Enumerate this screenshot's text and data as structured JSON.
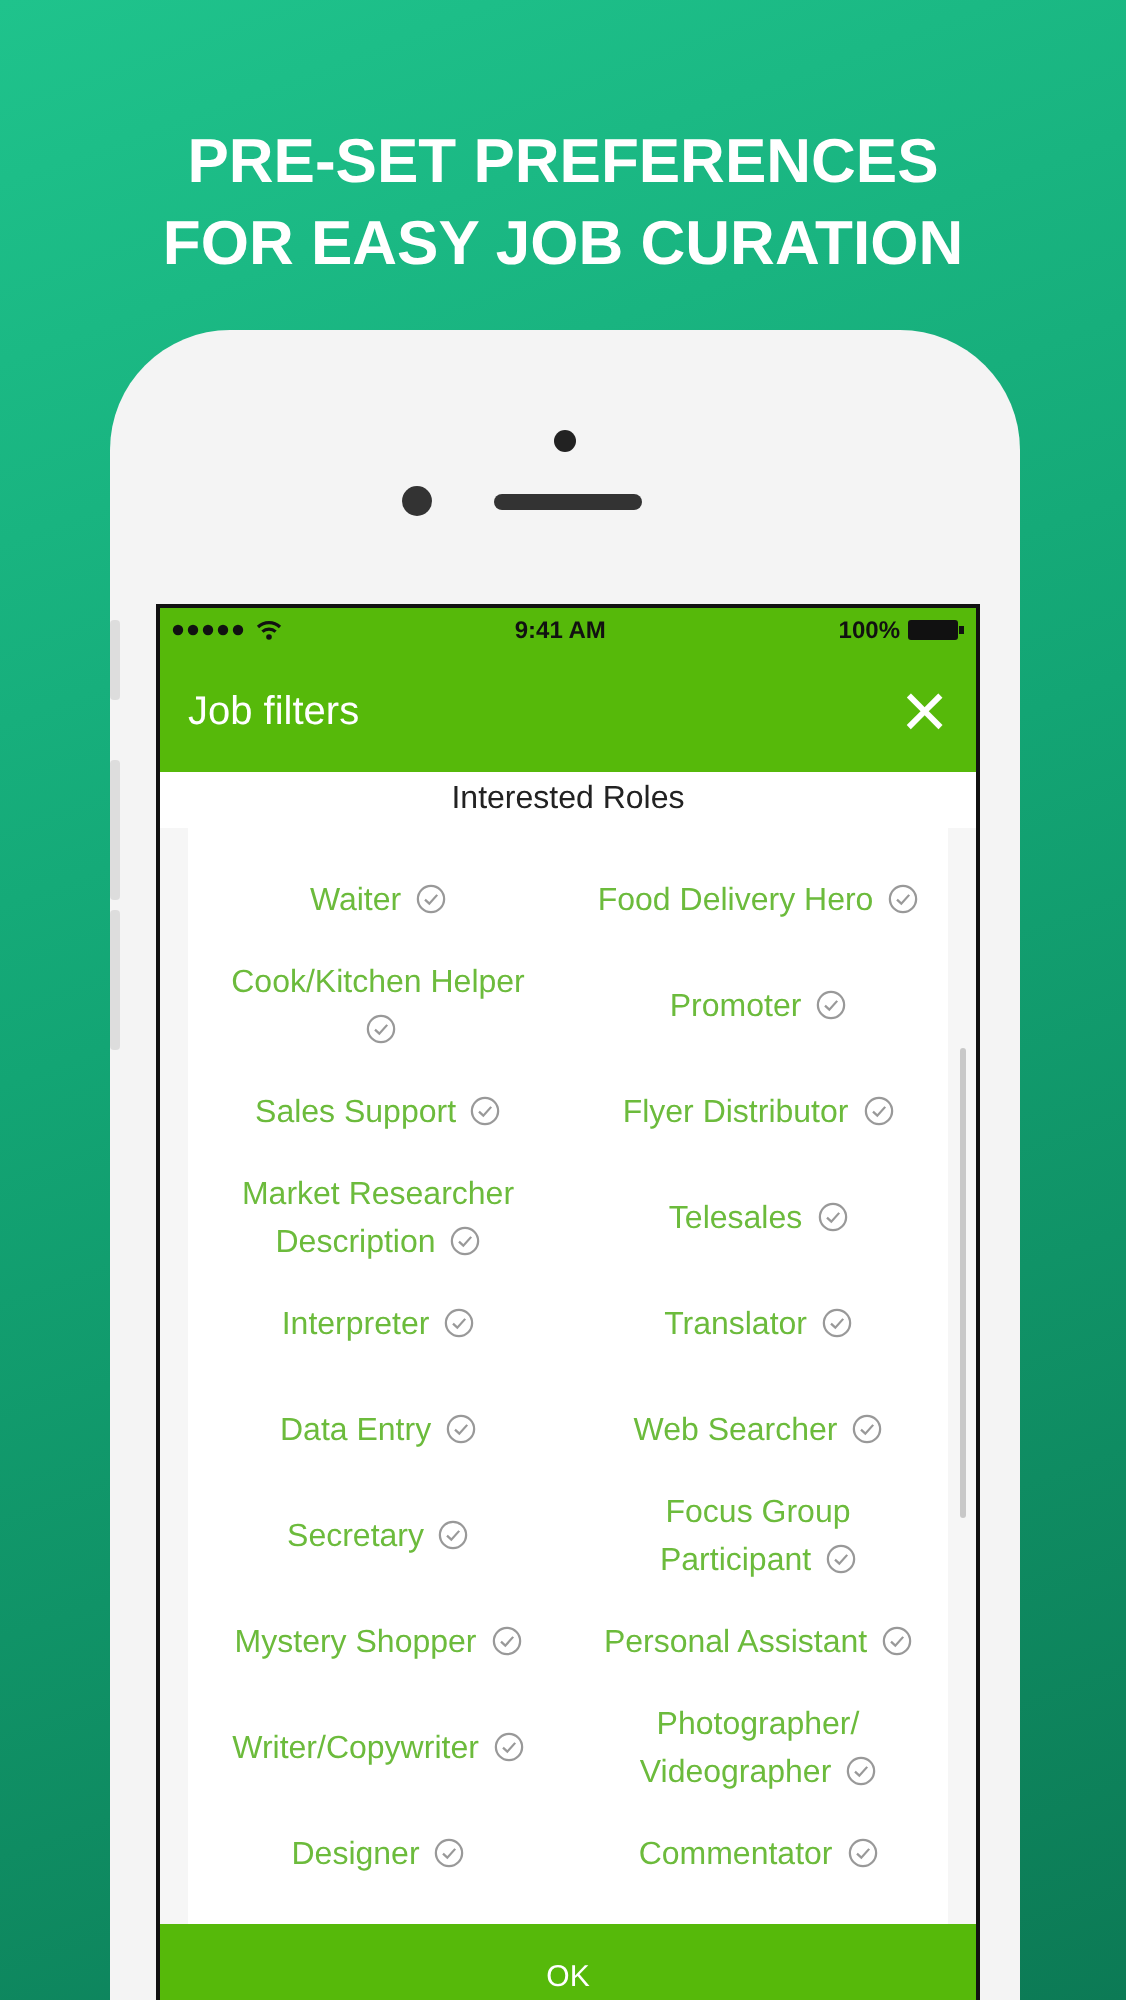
{
  "headline": [
    "PRE-SET PREFERENCES",
    "FOR EASY JOB CURATION"
  ],
  "status_bar": {
    "time": "9:41 AM",
    "battery": "100%"
  },
  "header": {
    "title": "Job filters",
    "close": "×"
  },
  "section_title": "Interested Roles",
  "roles": [
    {
      "label": "Waiter"
    },
    {
      "label": "Food Delivery Hero"
    },
    {
      "label": "Cook/Kitchen Helper"
    },
    {
      "label": "Promoter"
    },
    {
      "label": "Sales Support"
    },
    {
      "label": "Flyer Distributor"
    },
    {
      "label": "Market Researcher Description"
    },
    {
      "label": "Telesales"
    },
    {
      "label": "Interpreter"
    },
    {
      "label": "Translator"
    },
    {
      "label": "Data Entry"
    },
    {
      "label": "Web Searcher"
    },
    {
      "label": "Secretary"
    },
    {
      "label": "Focus Group Participant"
    },
    {
      "label": "Mystery Shopper"
    },
    {
      "label": "Personal Assistant"
    },
    {
      "label": "Writer/Copywriter"
    },
    {
      "label": "Photographer/ Videographer"
    },
    {
      "label": "Designer"
    },
    {
      "label": "Commentator"
    }
  ],
  "ok_button": "OK"
}
